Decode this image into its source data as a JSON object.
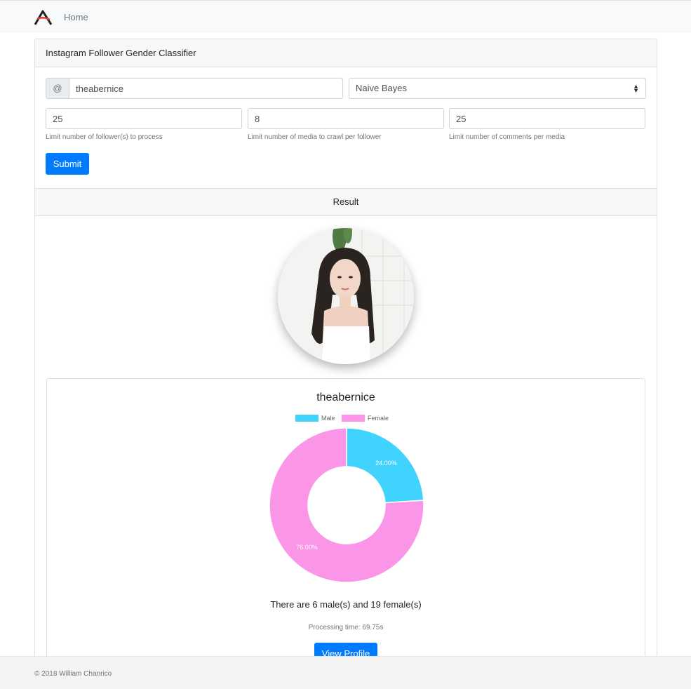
{
  "nav": {
    "home_label": "Home",
    "logo_icon": "brand-logo-icon"
  },
  "form": {
    "title": "Instagram Follower Gender Classifier",
    "username_prefix": "@",
    "username_value": "theabernice",
    "classifier_selected": "Naive Bayes",
    "followers_limit": "25",
    "followers_help": "Limit number of follower(s) to process",
    "media_limit": "8",
    "media_help": "Limit number of media to crawl per follower",
    "comments_limit": "25",
    "comments_help": "Limit number of comments per media",
    "submit_label": "Submit"
  },
  "result": {
    "header": "Result",
    "profile_name": "theabernice",
    "summary": "There are 6 male(s) and 19 female(s)",
    "processing_time": "Processing time: 69.75s",
    "view_profile_label": "View Profile"
  },
  "chart_data": {
    "type": "pie",
    "categories": [
      "Male",
      "Female"
    ],
    "values": [
      6,
      19
    ],
    "percent_labels": [
      "24.00%",
      "76.00%"
    ],
    "colors": [
      "#3fd3fd",
      "#fb95e8"
    ],
    "legend_position": "top"
  },
  "footer": {
    "copyright": "© 2018 William Chanrico"
  }
}
